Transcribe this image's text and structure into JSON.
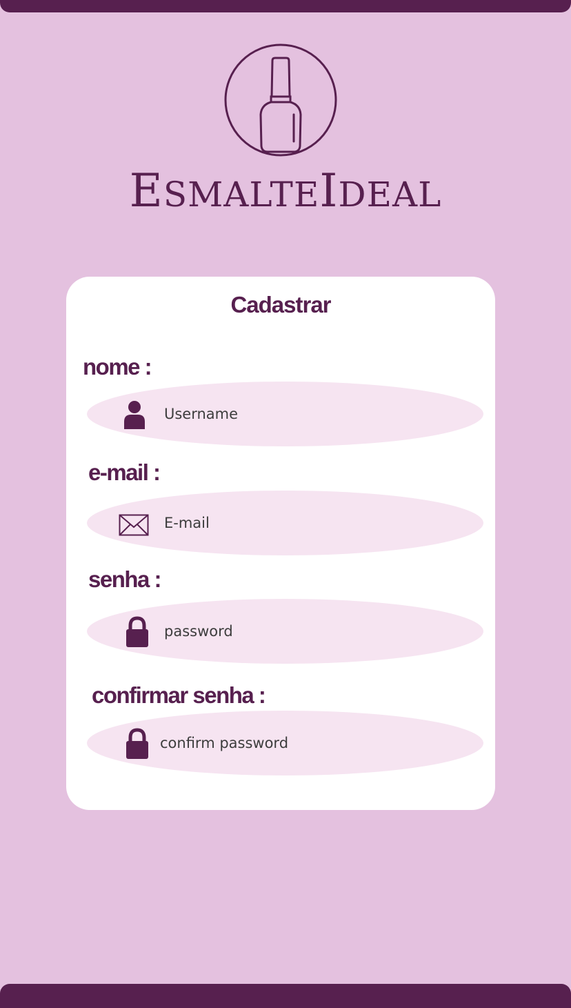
{
  "brand": {
    "logo_icon": "nail-polish-icon",
    "name_parts": [
      "E",
      "SMALTE",
      "I",
      "DEAL"
    ],
    "color": "#57204f"
  },
  "form": {
    "title": "Cadastrar",
    "fields": [
      {
        "label": "nome :",
        "placeholder": "Username",
        "icon": "user-icon"
      },
      {
        "label": "e-mail :",
        "placeholder": "E-mail",
        "icon": "envelope-icon"
      },
      {
        "label": "senha :",
        "placeholder": "password",
        "icon": "lock-icon"
      },
      {
        "label": "confirmar senha :",
        "placeholder": "confirm password",
        "icon": "lock-icon"
      }
    ]
  },
  "colors": {
    "background": "#e4c1df",
    "bar": "#57204f",
    "card": "#ffffff",
    "field": "#f6e4f1",
    "accent": "#57204f"
  }
}
